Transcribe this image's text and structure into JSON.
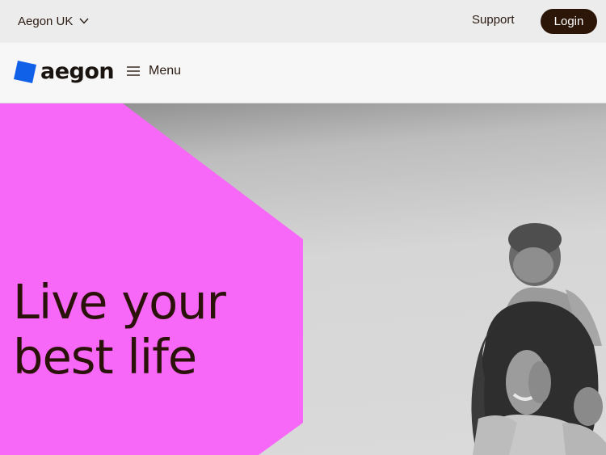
{
  "topbar": {
    "region_label": "Aegon UK",
    "region_icon": "chevron-down-icon",
    "support_label": "Support",
    "login_label": "Login"
  },
  "navbar": {
    "logo_text": "aegon",
    "menu_icon": "hamburger-icon",
    "menu_label": "Menu"
  },
  "hero": {
    "heading": "Live your best life",
    "accent_color": "#f868f8",
    "image": "woman-carrying-child-on-shoulders-photo"
  },
  "colors": {
    "brand_blue": "#1160e8",
    "login_bg": "#2b1607",
    "topbar_bg": "#ececec",
    "navbar_bg": "#f7f7f7",
    "text_dark": "#2a1a12"
  }
}
